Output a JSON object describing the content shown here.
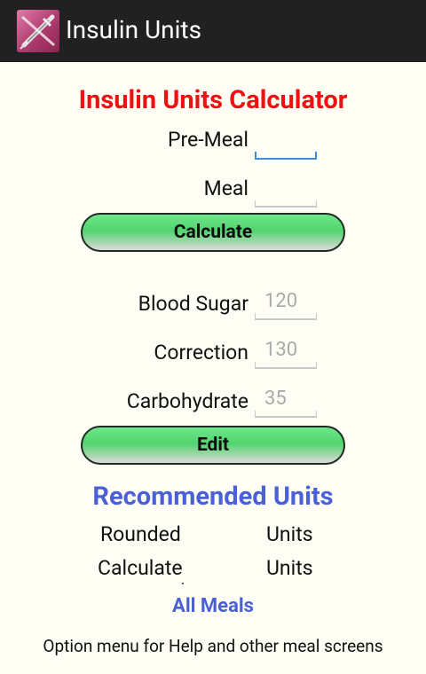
{
  "app": {
    "title": "Insulin Units"
  },
  "heading": "Insulin Units Calculator",
  "fields": {
    "pre_meal": {
      "label": "Pre-Meal",
      "value": ""
    },
    "meal": {
      "label": "Meal",
      "value": ""
    }
  },
  "calculate_label": "Calculate",
  "params": {
    "blood_sugar": {
      "label": "Blood Sugar",
      "value": "120"
    },
    "correction": {
      "label": "Correction",
      "value": "130"
    },
    "carbohydrate": {
      "label": "Carbohydrate",
      "value": "35"
    }
  },
  "edit_label": "Edit",
  "recommended": {
    "title": "Recommended Units",
    "rows": [
      {
        "label": "Rounded",
        "units": "Units"
      },
      {
        "label": "Calculate",
        "units": "Units"
      }
    ]
  },
  "all_meals_label": "All Meals",
  "hint": "Option menu for Help and other meal screens",
  "colors": {
    "action_bar": "#212121",
    "heading_red": "#ee1111",
    "heading_blue": "#4a60d6",
    "button_green": "#52d46f",
    "input_focus": "#3a8fd8"
  }
}
